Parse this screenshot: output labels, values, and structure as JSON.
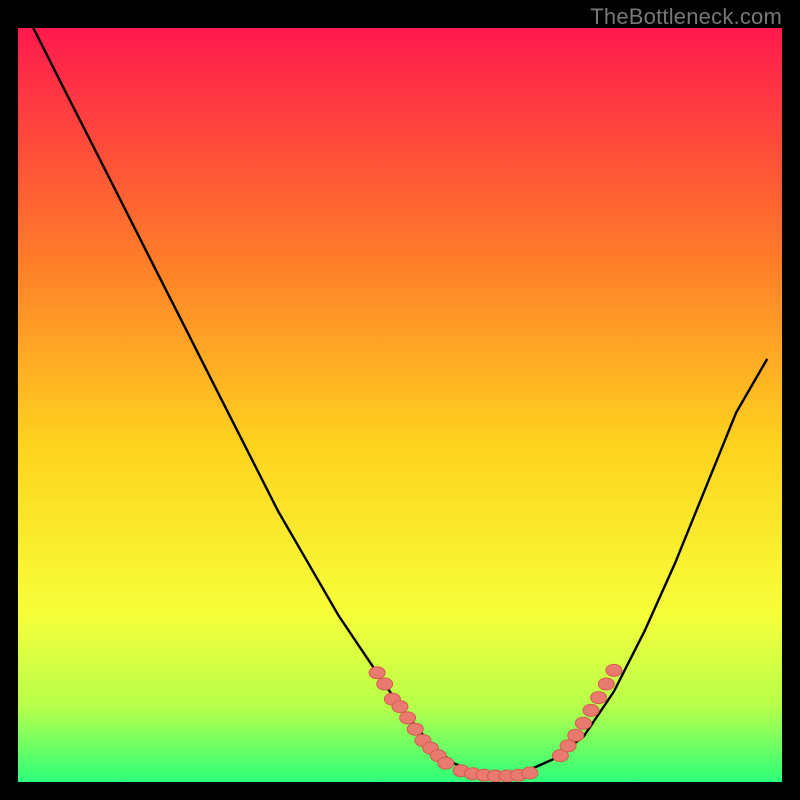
{
  "watermark": "TheBottleneck.com",
  "colors": {
    "bg": "#000000",
    "gradient_top": "#ff1a4d",
    "gradient_mid1": "#ff7a2a",
    "gradient_mid2": "#ffd21f",
    "gradient_mid3": "#f6ff3a",
    "gradient_bottom1": "#b6ff4a",
    "gradient_bottom2": "#2cff7a",
    "curve": "#000000",
    "dot_fill": "#e97a6f",
    "dot_stroke": "#d85a4e"
  },
  "chart_data": {
    "type": "line",
    "title": "",
    "xlabel": "",
    "ylabel": "",
    "xlim": [
      0,
      100
    ],
    "ylim": [
      0,
      100
    ],
    "grid": false,
    "legend": false,
    "series": [
      {
        "name": "curve",
        "x": [
          2,
          6,
          10,
          14,
          18,
          22,
          26,
          30,
          34,
          38,
          42,
          46,
          50,
          54,
          57,
          60,
          63,
          66,
          70,
          74,
          78,
          82,
          86,
          90,
          94,
          98
        ],
        "y": [
          100,
          92,
          84,
          76,
          68,
          60,
          52,
          44,
          36,
          29,
          22,
          16,
          10,
          5,
          2.5,
          1.2,
          0.7,
          1.2,
          3,
          6,
          12,
          20,
          29,
          39,
          49,
          56
        ]
      }
    ],
    "scatter_clusters": [
      {
        "name": "left-dots",
        "points": [
          [
            47,
            14.5
          ],
          [
            48,
            13
          ],
          [
            49,
            11
          ],
          [
            50,
            10
          ],
          [
            51,
            8.5
          ],
          [
            52,
            7
          ],
          [
            53,
            5.5
          ],
          [
            54,
            4.5
          ],
          [
            55,
            3.5
          ],
          [
            56,
            2.5
          ]
        ]
      },
      {
        "name": "bottom-dots",
        "points": [
          [
            58,
            1.5
          ],
          [
            59.5,
            1.1
          ],
          [
            61,
            0.9
          ],
          [
            62.5,
            0.8
          ],
          [
            64,
            0.8
          ],
          [
            65.5,
            0.9
          ],
          [
            67,
            1.2
          ]
        ]
      },
      {
        "name": "right-dots",
        "points": [
          [
            71,
            3.5
          ],
          [
            72,
            4.8
          ],
          [
            73,
            6.2
          ],
          [
            74,
            7.8
          ],
          [
            75,
            9.5
          ],
          [
            76,
            11.2
          ],
          [
            77,
            13
          ],
          [
            78,
            14.8
          ]
        ]
      }
    ]
  }
}
